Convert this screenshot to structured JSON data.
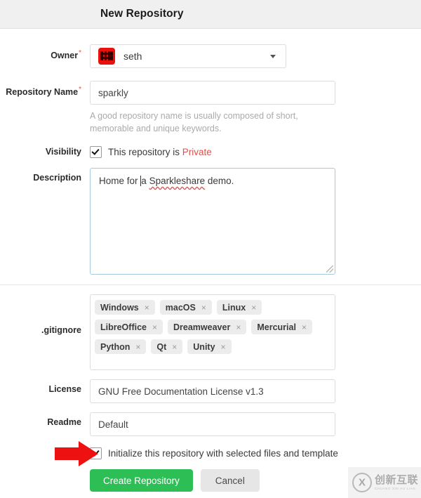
{
  "header": {
    "title": "New Repository"
  },
  "form": {
    "owner": {
      "label": "Owner",
      "required_marker": "*",
      "value": "seth",
      "avatar_alt": "seth-avatar",
      "dropdown_icon": "chevron-down-icon"
    },
    "repository_name": {
      "label": "Repository Name",
      "required_marker": "*",
      "value": "sparkly",
      "help": "A good repository name is usually composed of short, memorable and unique keywords."
    },
    "visibility": {
      "label": "Visibility",
      "checked": true,
      "text_prefix": "This repository is ",
      "text_private": "Private"
    },
    "description": {
      "label": "Description",
      "value_before_caret": "Home for ",
      "value_word_misspelled": "Sparkleshare",
      "value_after": " demo.",
      "value_caret_word": "a",
      "full_value": "Home for a Sparkleshare demo."
    },
    "gitignore": {
      "label": ".gitignore",
      "tags": [
        "Windows",
        "macOS",
        "Linux",
        "LibreOffice",
        "Dreamweaver",
        "Mercurial",
        "Python",
        "Qt",
        "Unity"
      ],
      "remove_glyph": "×"
    },
    "license": {
      "label": "License",
      "value": "GNU Free Documentation License v1.3"
    },
    "readme": {
      "label": "Readme",
      "value": "Default"
    },
    "initialize": {
      "checked": true,
      "label": "Initialize this repository with selected files and template"
    }
  },
  "actions": {
    "create_label": "Create Repository",
    "cancel_label": "Cancel"
  },
  "annotation": {
    "arrow_color": "#ee1111",
    "arrow_name": "red-pointer-arrow"
  },
  "watermark": {
    "cn_text": "创新互联",
    "sub_text": "CHUANG XIN HU LIAN",
    "logo_letter": "X"
  },
  "colors": {
    "primary_button": "#2dbe56",
    "secondary_button": "#e6e6e6",
    "required_red": "#d9534f",
    "private_red": "#d9534f",
    "avatar_red": "#e8120d",
    "header_bg": "#f0f0f0",
    "focus_border": "#a8cade"
  }
}
